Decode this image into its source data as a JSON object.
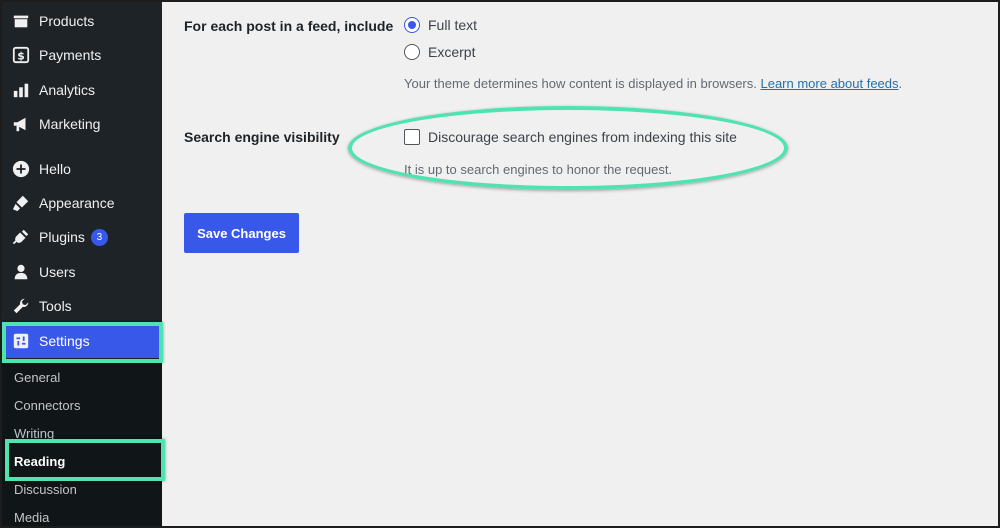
{
  "sidebar": {
    "items": [
      {
        "label": "Products",
        "icon": "box-icon"
      },
      {
        "label": "Payments",
        "icon": "dollar-icon"
      },
      {
        "label": "Analytics",
        "icon": "bar-chart-icon"
      },
      {
        "label": "Marketing",
        "icon": "megaphone-icon"
      },
      {
        "label": "Hello",
        "icon": "plus-circle-icon"
      },
      {
        "label": "Appearance",
        "icon": "brush-icon"
      },
      {
        "label": "Plugins",
        "icon": "plug-icon",
        "badge": "3"
      },
      {
        "label": "Users",
        "icon": "user-icon"
      },
      {
        "label": "Tools",
        "icon": "wrench-icon"
      },
      {
        "label": "Settings",
        "icon": "settings-icon"
      }
    ],
    "submenu": [
      "General",
      "Connectors",
      "Writing",
      "Reading",
      "Discussion",
      "Media"
    ]
  },
  "feed": {
    "label": "For each post in a feed, include",
    "options": [
      "Full text",
      "Excerpt"
    ],
    "selected": "Full text",
    "desc_text": "Your theme determines how content is displayed in browsers. ",
    "desc_link": "Learn more about feeds",
    "desc_end": "."
  },
  "visibility": {
    "label": "Search engine visibility",
    "checkbox_label": "Discourage search engines from indexing this site",
    "checked": false,
    "desc": "It is up to search engines to honor the request."
  },
  "save_label": "Save Changes",
  "colors": {
    "accent": "#3858e9",
    "highlight": "#4fe3b0",
    "sidebar": "#1d2327"
  }
}
